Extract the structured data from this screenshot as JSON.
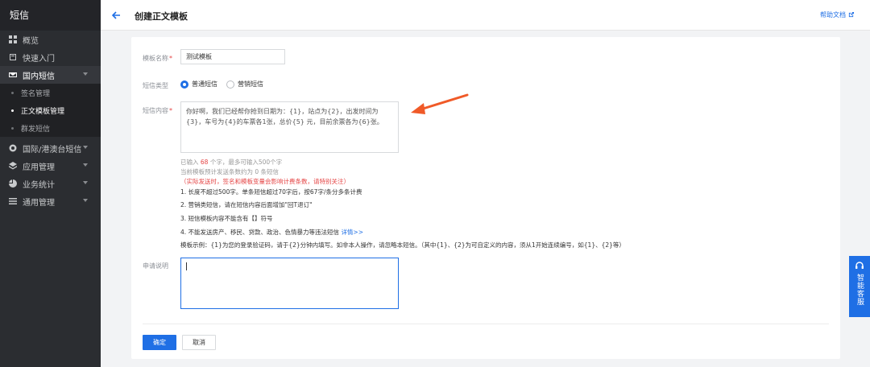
{
  "sidebar": {
    "brand": "短信",
    "items": [
      {
        "label": "概览",
        "icon": "grid-icon"
      },
      {
        "label": "快速入门",
        "icon": "book-icon"
      },
      {
        "label": "国内短信",
        "icon": "mail-icon"
      },
      {
        "label": "国际/港澳台短信",
        "icon": "globe-icon"
      },
      {
        "label": "应用管理",
        "icon": "layers-icon"
      },
      {
        "label": "业务统计",
        "icon": "pie-icon"
      },
      {
        "label": "通用管理",
        "icon": "list-icon"
      }
    ],
    "subitems": [
      "签名管理",
      "正文模板管理",
      "群发短信"
    ]
  },
  "header": {
    "title": "创建正文模板",
    "help": "帮助文档"
  },
  "form": {
    "name_label": "模板名称",
    "name_value": "测试模板",
    "type_label": "短信类型",
    "type_options": [
      "普通短信",
      "营销短信"
    ],
    "content_label": "短信内容",
    "content_value": "你好啊，我们已经帮你抢到日期为：{1}，站点为{2}，出发时间为{3}，车号为{4}的车票各1张，总价{5} 元，目前余票各为{6}张。",
    "count_prefix": "已输入 ",
    "count_value": "68",
    "count_suffix": " 个字，最多可输入500个字",
    "estimate": "当前模板预计发送条数约为 0 条短信",
    "warning": "（实际发送时，签名和模板变量会影响计费条数，请特别关注）",
    "rules": [
      "1. 长度不超过500字。单条短信超过70字后，按67字/条分多条计费",
      "2. 营销类短信，请在短信内容后面增加\"回T退订\"",
      "3. 短信模板内容不能含有【】符号",
      "4. 不能发送房产、移民、贷款、政治、色情暴力等违法短信 "
    ],
    "rule_link": "详情>>",
    "example": "模板示例：{1}为您的登录验证码，请于{2}分钟内填写。如非本人操作，请忽略本短信。（其中{1}、{2}为可自定义的内容，须从1开始连续编号，如{1}、{2}等）",
    "desc_label": "申请说明",
    "submit": "确定",
    "cancel": "取消"
  },
  "service": {
    "label": "智能客服"
  },
  "colors": {
    "accent": "#1f6fe5",
    "sidebar": "#2b2d31",
    "annotation": "#f05a28"
  }
}
